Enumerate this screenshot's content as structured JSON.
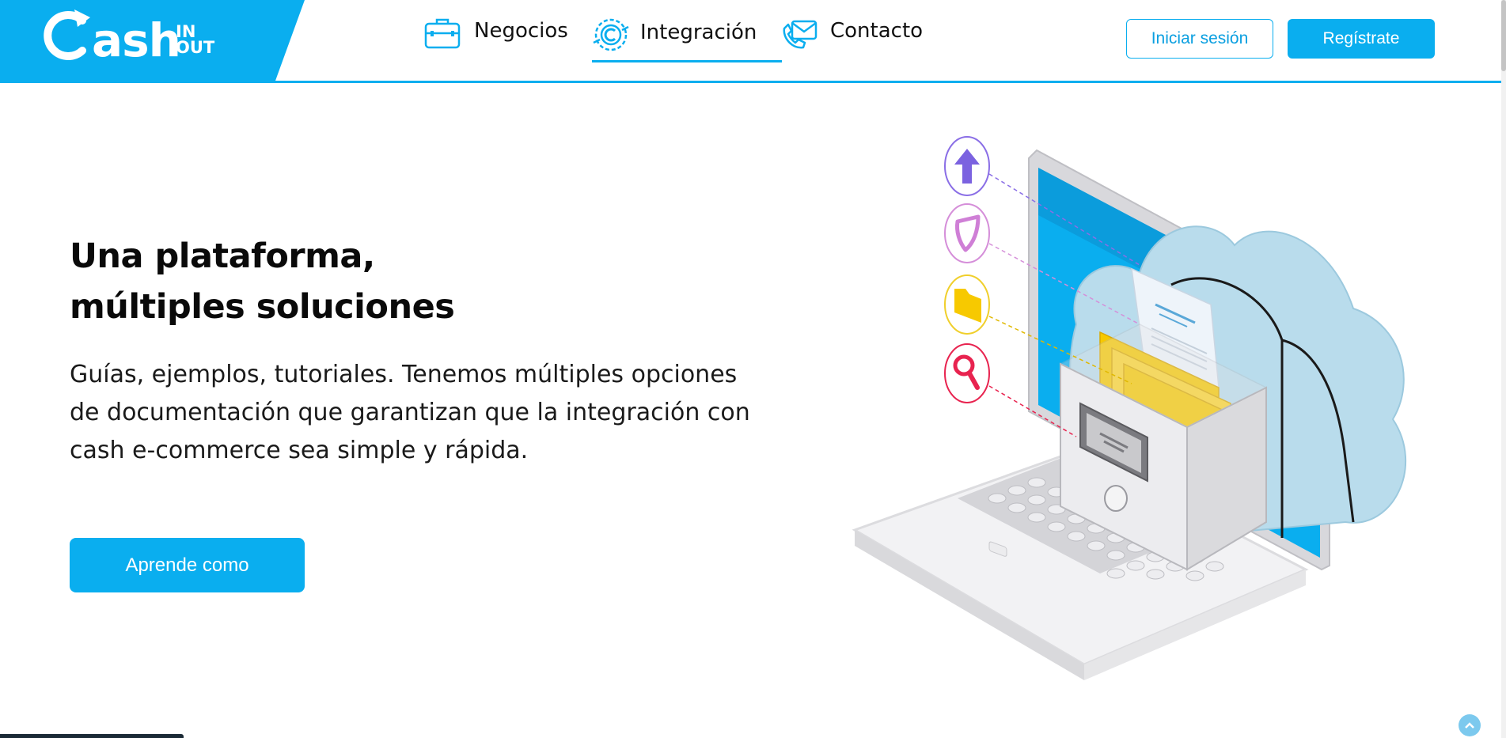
{
  "brand": {
    "logo_word": "ash",
    "logo_in": "IN",
    "logo_out": "OUT",
    "color_primary": "#0aaeef"
  },
  "nav": {
    "items": [
      {
        "label": "Negocios",
        "icon": "briefcase-icon"
      },
      {
        "label": "Integración",
        "icon": "gear-integration-icon"
      },
      {
        "label": "Contacto",
        "icon": "envelope-phone-icon"
      }
    ],
    "active": "Integración"
  },
  "header": {
    "login_label": "Iniciar sesión",
    "register_label": "Regístrate"
  },
  "hero": {
    "title_line1": "Una plataforma,",
    "title_line2": "múltiples soluciones",
    "description": "Guías, ejemplos, tutoriales. Tenemos múltiples opciones de documentación que garantizan que la integración con cash e-commerce sea simple y rápida.",
    "cta_label": "Aprende como"
  },
  "illustration": {
    "subject": "computer-cloud-file-cabinet-illustration",
    "icons": [
      "upload-arrow-icon",
      "shield-icon",
      "folder-icon",
      "magnifier-icon"
    ]
  }
}
